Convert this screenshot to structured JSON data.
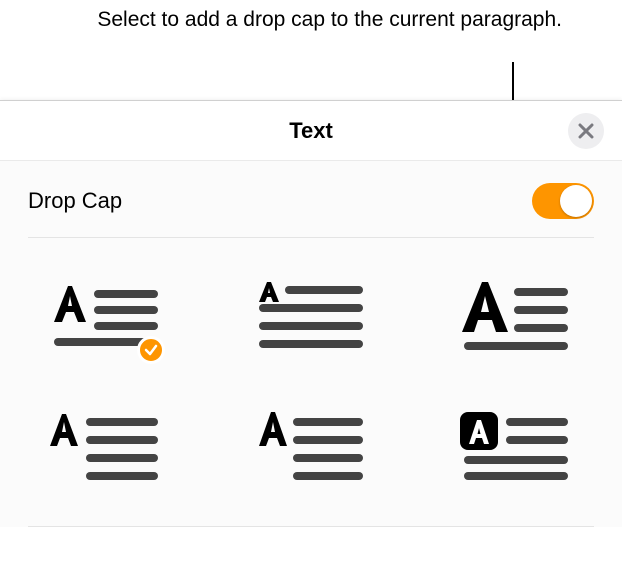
{
  "accent_color": "#fe9500",
  "callout": {
    "text": "Select to add a drop cap to the current paragraph."
  },
  "panel": {
    "title": "Text",
    "close_icon": "close"
  },
  "drop_cap": {
    "label": "Drop Cap",
    "enabled": true,
    "selected_style_index": 0,
    "styles": [
      {
        "id": "raised-2line",
        "name": "Raised, wraps two lines"
      },
      {
        "id": "inline-3line",
        "name": "Small inline, three lines"
      },
      {
        "id": "dropped-3line",
        "name": "Large dropped, three lines"
      },
      {
        "id": "margin-left",
        "name": "In left margin"
      },
      {
        "id": "inline-tall",
        "name": "Tall inline"
      },
      {
        "id": "boxed-reverse",
        "name": "Boxed reversed letter"
      }
    ]
  }
}
